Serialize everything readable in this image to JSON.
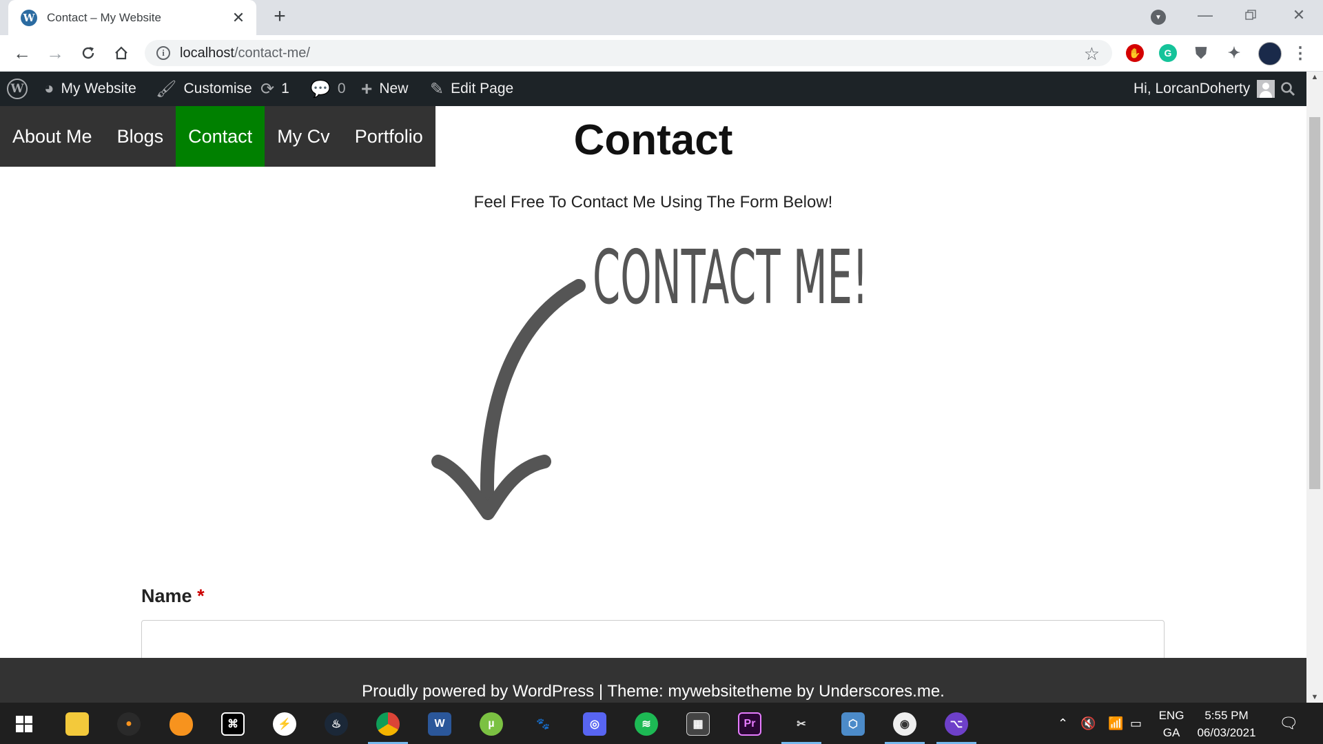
{
  "browser": {
    "tab_title": "Contact – My Website",
    "tab_favicon": "W",
    "tab_close": "✕",
    "new_tab": "+",
    "url_host": "localhost",
    "url_path": "/contact-me/"
  },
  "admin_bar": {
    "site_name": "My Website",
    "customise": "Customise",
    "updates_count": "1",
    "comments_count": "0",
    "new_label": "New",
    "edit_page": "Edit Page",
    "greeting": "Hi, LorcanDoherty"
  },
  "site_nav": {
    "items": [
      "About Me",
      "Blogs",
      "Contact",
      "My Cv",
      "Portfolio"
    ],
    "active": "Contact",
    "active_color": "#008000"
  },
  "page": {
    "title": "Contact",
    "subtitle": "Feel Free To Contact Me Using The Form Below!",
    "image_text": "CONTACT ME!",
    "name_label": "Name",
    "required_marker": "*"
  },
  "footer": {
    "text": "Proudly powered by WordPress | Theme: mywebsitetheme by Underscores.me."
  },
  "taskbar": {
    "lang_line1": "ENG",
    "lang_line2": "GA",
    "time": "5:55 PM",
    "date": "06/03/2021"
  }
}
